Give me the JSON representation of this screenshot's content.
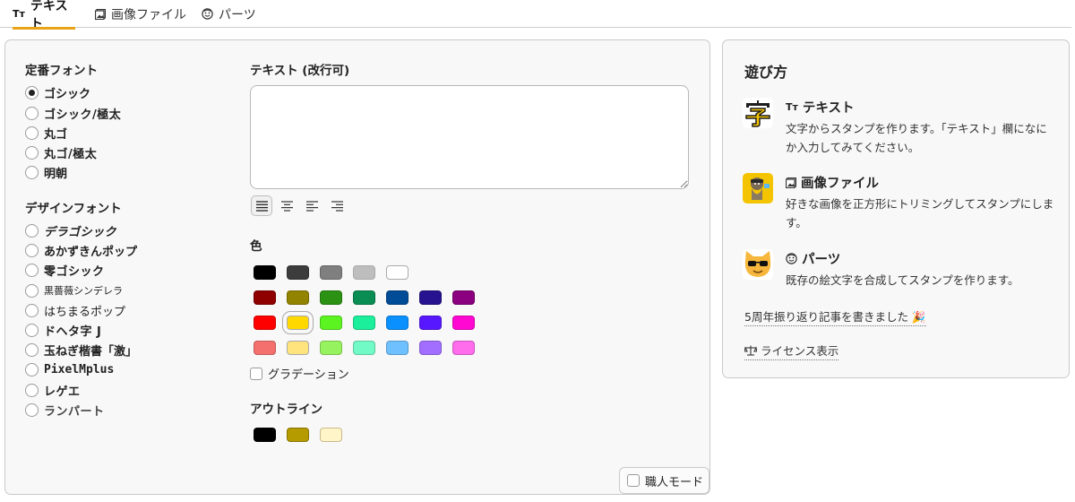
{
  "tabs": [
    {
      "icon": "text-icon",
      "glyph": "Tт",
      "label": "テキスト",
      "active": true
    },
    {
      "icon": "image-icon",
      "label": "画像ファイル",
      "active": false
    },
    {
      "icon": "face-icon",
      "label": "パーツ",
      "active": false
    }
  ],
  "editor": {
    "standard_fonts_label": "定番フォント",
    "standard_fonts": [
      "ゴシック",
      "ゴシック/極太",
      "丸ゴ",
      "丸ゴ/極太",
      "明朝"
    ],
    "selected_font": "ゴシック",
    "design_fonts_label": "デザインフォント",
    "design_fonts": [
      "デラゴシック",
      "あかずきんポップ",
      "零ゴシック",
      "黒薔薇シンデレラ",
      "はちまるポップ",
      "ドヘタ字 J",
      "玉ねぎ楷書「激」",
      "PixelMplus",
      "レゲエ",
      "ランパート"
    ],
    "text_label": "テキスト (改行可)",
    "text_value": "",
    "align_options": [
      "justify",
      "center",
      "left",
      "right"
    ],
    "selected_align": "justify",
    "color_label": "色",
    "colors": [
      [
        "#000000",
        "#3c3c3c",
        "#7f7f7f",
        "#bdbdbd",
        "#ffffff"
      ],
      [
        "#8f0000",
        "#928400",
        "#2c9213",
        "#0a8d52",
        "#004c96",
        "#27138f",
        "#8a007e"
      ],
      [
        "#ff0000",
        "#ffd800",
        "#5cf420",
        "#1bef9b",
        "#0a90ff",
        "#5818ff",
        "#ff08d2"
      ],
      [
        "#f4706e",
        "#ffe37c",
        "#96f25e",
        "#72fac6",
        "#6fc0ff",
        "#a26eff",
        "#ff6cec"
      ]
    ],
    "selected_color": "#ffd800",
    "gradient_label": "グラデーション",
    "outline_label": "アウトライン",
    "outline_colors": [
      "#000000",
      "#b59a00",
      "#fff5c8"
    ],
    "pro_mode_label": "職人モード"
  },
  "help": {
    "title": "遊び方",
    "items": [
      {
        "icon": "text-icon",
        "glyph": "Tт",
        "heading": "テキスト",
        "desc": "文字からスタンプを作ります。「テキスト」欄になにか入力してみてください。"
      },
      {
        "icon": "image-icon",
        "heading": "画像ファイル",
        "desc": "好きな画像を正方形にトリミングしてスタンプにします。"
      },
      {
        "icon": "face-icon",
        "heading": "パーツ",
        "desc": "既存の絵文字を合成してスタンプを作ります。"
      }
    ],
    "anniversary_link": "5周年振り返り記事を書きました 🎉",
    "license_link": "ライセンス表示"
  }
}
